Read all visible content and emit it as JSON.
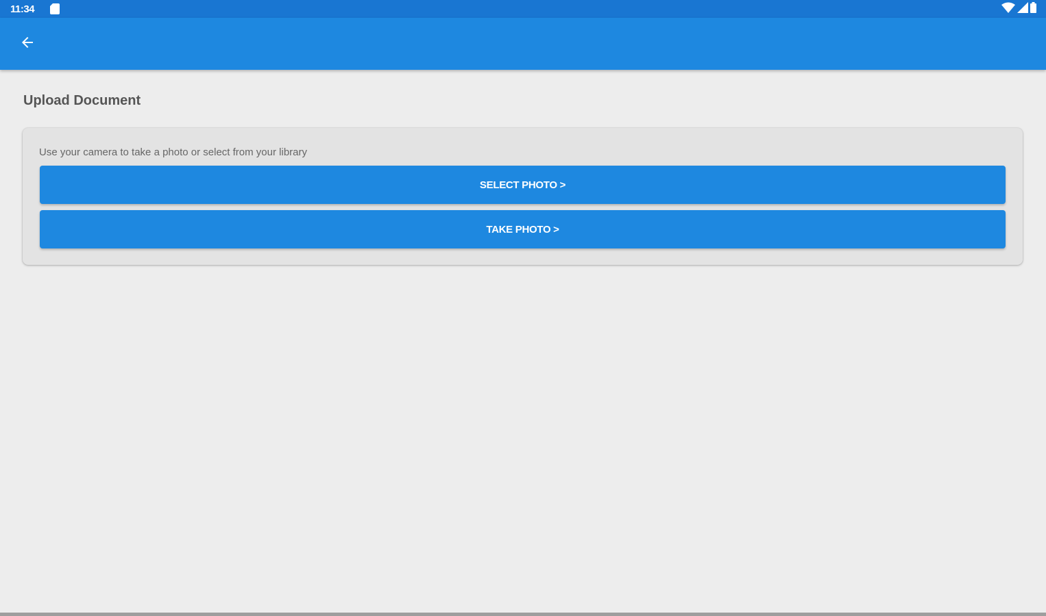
{
  "status_bar": {
    "time": "11:34",
    "icons": [
      "sd-card-icon",
      "wifi-icon",
      "cell-signal-icon",
      "battery-icon"
    ]
  },
  "app_bar": {
    "back_icon": "arrow-back-icon"
  },
  "page": {
    "title": "Upload Document"
  },
  "upload_card": {
    "hint": "Use your camera to take a photo or select from your library",
    "select_photo_label": "SELECT PHOTO >",
    "take_photo_label": "TAKE PHOTO >"
  },
  "colors": {
    "status_bar": "#1976d2",
    "app_bar": "#1e88e0",
    "button": "#1e88e0",
    "background": "#ededed",
    "card": "#e3e3e3"
  }
}
